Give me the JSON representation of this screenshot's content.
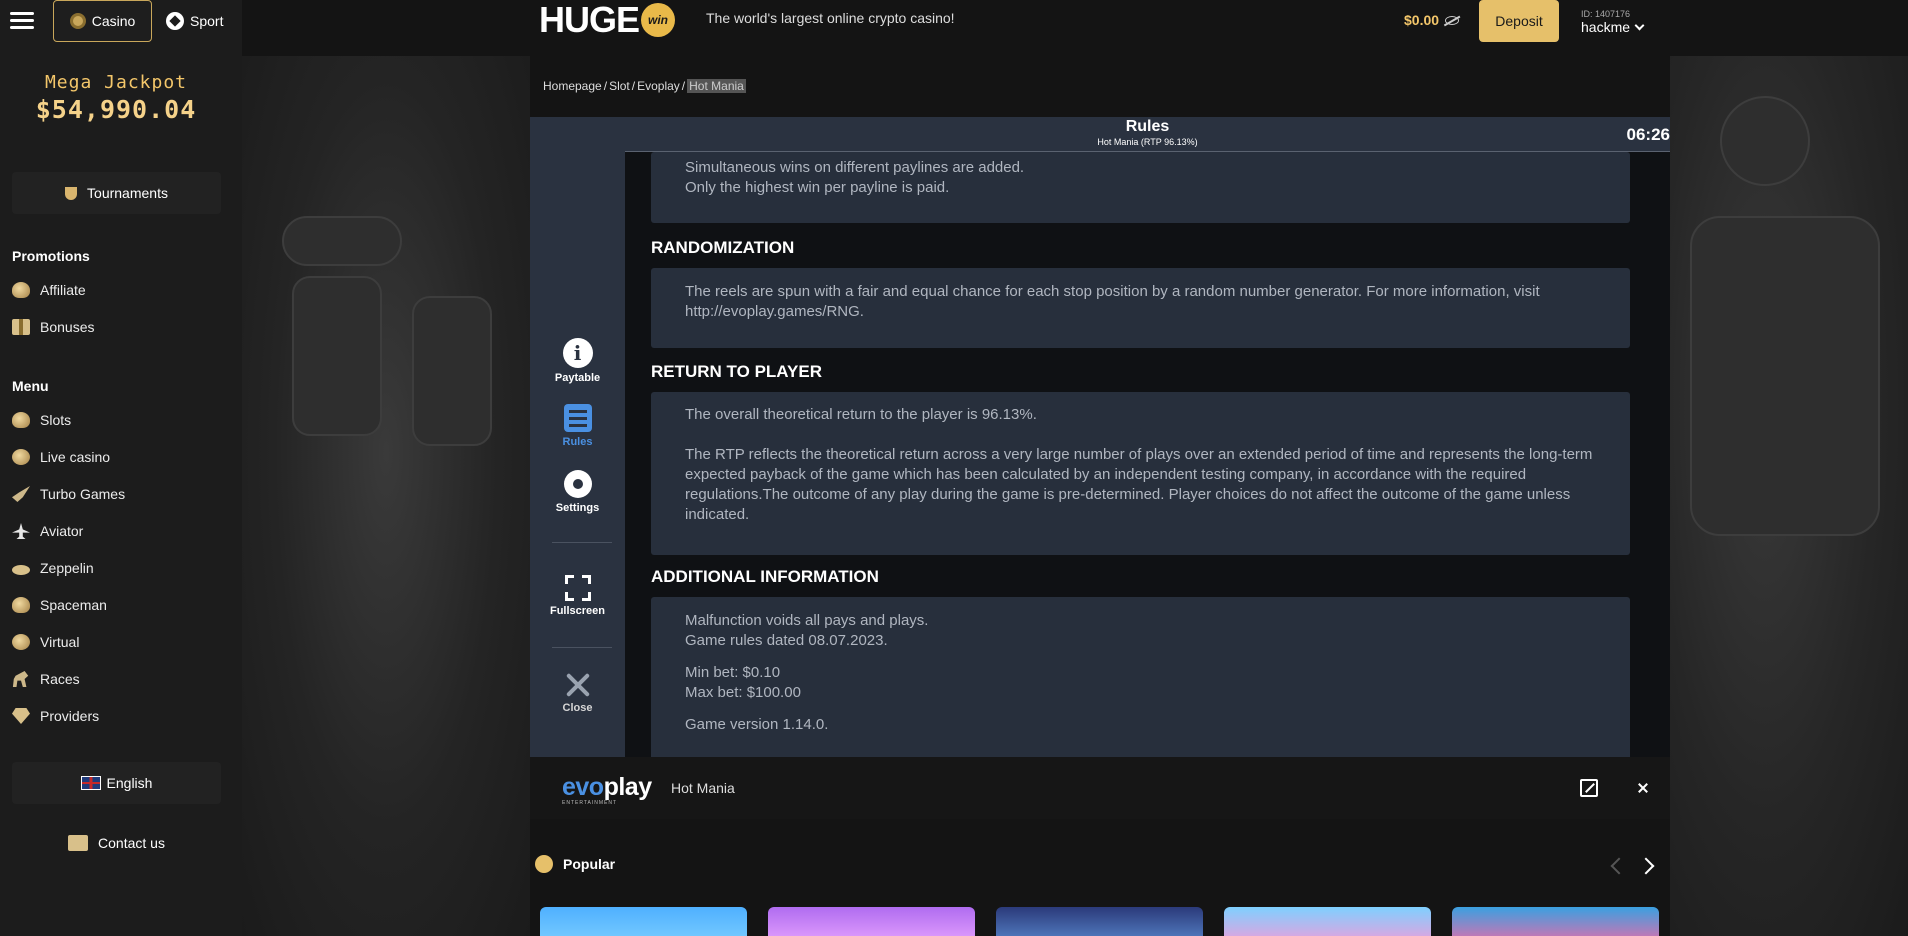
{
  "header": {
    "casino_label": "Casino",
    "sport_label": "Sport",
    "logo_text": "HUGE",
    "logo_badge": "win",
    "tagline": "The world's largest online crypto casino!",
    "balance": "$0.00",
    "deposit_label": "Deposit",
    "user_id": "ID: 1407176",
    "username": "hackme",
    "colors": {
      "accent": "#e6c06a",
      "balance": "#f3c66a"
    }
  },
  "sidebar": {
    "jackpot_title": "Mega Jackpot",
    "jackpot_value": "$54,990.04",
    "tournaments_label": "Tournaments",
    "promotions_title": "Promotions",
    "promotions": [
      {
        "label": "Affiliate",
        "icon": "affiliate-icon"
      },
      {
        "label": "Bonuses",
        "icon": "gift-icon"
      }
    ],
    "menu_title": "Menu",
    "menu": [
      {
        "label": "Slots",
        "icon": "slots-icon"
      },
      {
        "label": "Live casino",
        "icon": "chip-icon"
      },
      {
        "label": "Turbo Games",
        "icon": "rocket-icon"
      },
      {
        "label": "Aviator",
        "icon": "plane-icon"
      },
      {
        "label": "Zeppelin",
        "icon": "zeppelin-icon"
      },
      {
        "label": "Spaceman",
        "icon": "spaceman-icon"
      },
      {
        "label": "Virtual",
        "icon": "ball-icon"
      },
      {
        "label": "Races",
        "icon": "horse-icon"
      },
      {
        "label": "Providers",
        "icon": "gem-icon"
      }
    ],
    "language_label": "English",
    "contact_label": "Contact us"
  },
  "breadcrumb": [
    "Homepage",
    "Slot",
    "Evoplay",
    "Hot Mania"
  ],
  "game": {
    "side_buttons": {
      "paytable": "Paytable",
      "rules": "Rules",
      "settings": "Settings",
      "fullscreen": "Fullscreen",
      "close": "Close"
    },
    "rules_title": "Rules",
    "rules_subtitle": "Hot Mania (RTP 96.13%)",
    "clock": "06:26",
    "top_text": [
      "Simultaneous wins on different paylines are added.",
      "Only the highest win per payline is paid."
    ],
    "sections": [
      {
        "title": "RANDOMIZATION",
        "paragraphs": [
          "The reels are spun with a fair and equal chance for each stop position by a random number generator. For more information, visit http://evoplay.games/RNG."
        ]
      },
      {
        "title": "RETURN TO PLAYER",
        "paragraphs": [
          "The overall theoretical return to the player is 96.13%.",
          "The RTP reflects the theoretical return across a very large number of plays over an extended period of time and represents the long-term expected payback of the game which has been calculated by an independent testing company, in accordance with the required regulations.The outcome of any play during the game is pre-determined. Player choices do not affect the outcome of the game unless indicated."
        ]
      },
      {
        "title": "ADDITIONAL INFORMATION",
        "paragraphs": [
          "Malfunction voids all pays and plays.",
          "Game rules dated 08.07.2023.",
          "Min bet: $0.10",
          "Max bet: $100.00",
          "Game version 1.14.0."
        ]
      }
    ]
  },
  "footer": {
    "provider_name": "evoplay",
    "provider_sub": "ENTERTAINMENT",
    "game_name": "Hot Mania"
  },
  "popular": {
    "title": "Popular"
  }
}
